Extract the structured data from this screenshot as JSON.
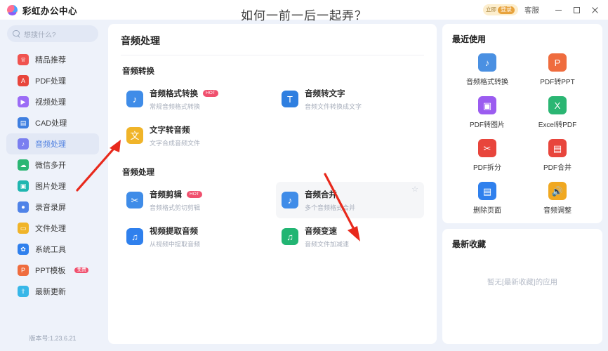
{
  "titlebar": {
    "brand": "彩虹办公中心",
    "login_left": "立即",
    "login_right": "登录",
    "service": "客服",
    "minimize_icon": "minimize-icon",
    "maximize_icon": "maximize-icon",
    "close_icon": "close-icon"
  },
  "overlay": {
    "caption": "如何一前一后一起弄？"
  },
  "sidebar": {
    "search_placeholder": "想搜什么?",
    "version": "版本号:1.23.6.21",
    "items": [
      {
        "label": "精品推荐",
        "icon": "gift-icon",
        "color": "#f0534f",
        "glyph": "♕",
        "active": false
      },
      {
        "label": "PDF处理",
        "icon": "pdf-icon",
        "color": "#e8453c",
        "glyph": "A",
        "active": false
      },
      {
        "label": "视频处理",
        "icon": "video-icon",
        "color": "#9b6cf6",
        "glyph": "▶",
        "active": false
      },
      {
        "label": "CAD处理",
        "icon": "cad-icon",
        "color": "#3f7fe0",
        "glyph": "▤",
        "active": false
      },
      {
        "label": "音频处理",
        "icon": "audio-icon",
        "color": "#7a7ef0",
        "glyph": "♪",
        "active": true
      },
      {
        "label": "微信多开",
        "icon": "wechat-icon",
        "color": "#2bb673",
        "glyph": "☁",
        "active": false
      },
      {
        "label": "图片处理",
        "icon": "image-icon",
        "color": "#1fb6b0",
        "glyph": "▣",
        "active": false
      },
      {
        "label": "录音录屏",
        "icon": "record-icon",
        "color": "#4f83e8",
        "glyph": "⏺",
        "active": false
      },
      {
        "label": "文件处理",
        "icon": "folder-icon",
        "color": "#f0b429",
        "glyph": "▭",
        "active": false
      },
      {
        "label": "系统工具",
        "icon": "gear-icon",
        "color": "#2f80ed",
        "glyph": "✿",
        "active": false
      },
      {
        "label": "PPT模板",
        "icon": "ppt-icon",
        "color": "#ef6c3e",
        "glyph": "P",
        "active": false,
        "badge": "免费"
      },
      {
        "label": "最新更新",
        "icon": "update-icon",
        "color": "#37b7e8",
        "glyph": "⇪",
        "active": false
      }
    ]
  },
  "main": {
    "page_title": "音频处理",
    "groups": [
      {
        "title": "音频转换",
        "tools": [
          {
            "name": "音频格式转换",
            "sub": "常规音频格式转换",
            "icon": "audio-convert-icon",
            "color": "#3f8ce8",
            "glyph": "♪",
            "badge": "HOT",
            "highlight": false,
            "star": false
          },
          {
            "name": "音频转文字",
            "sub": "音频文件转换成文字",
            "icon": "audio-to-text-icon",
            "color": "#2f7fe0",
            "glyph": "T",
            "badge": "",
            "highlight": false,
            "star": false
          },
          {
            "name": "文字转音频",
            "sub": "文字合成音频文件",
            "icon": "text-to-audio-icon",
            "color": "#f0b429",
            "glyph": "文",
            "badge": "",
            "highlight": false,
            "star": false
          }
        ]
      },
      {
        "title": "音频处理",
        "tools": [
          {
            "name": "音频剪辑",
            "sub": "音频格式剪切剪辑",
            "icon": "audio-clip-icon",
            "color": "#3f8ce8",
            "glyph": "✂",
            "badge": "HOT",
            "highlight": false,
            "star": false
          },
          {
            "name": "音频合并",
            "sub": "多个音频格式合并",
            "icon": "audio-merge-icon",
            "color": "#3f8ce8",
            "glyph": "♪",
            "badge": "",
            "highlight": true,
            "star": true
          },
          {
            "name": "视频提取音频",
            "sub": "从视频中提取音频",
            "icon": "video-extract-icon",
            "color": "#2f80ed",
            "glyph": "♫",
            "badge": "",
            "highlight": false,
            "star": false
          },
          {
            "name": "音频变速",
            "sub": "音频文件加减速",
            "icon": "audio-speed-icon",
            "color": "#22b573",
            "glyph": "♫",
            "badge": "",
            "highlight": false,
            "star": false
          }
        ]
      }
    ]
  },
  "recent": {
    "title": "最近使用",
    "items": [
      {
        "label": "音频格式转换",
        "icon": "audio-convert-icon",
        "color": "#4a90e2",
        "glyph": "♪"
      },
      {
        "label": "PDF转PPT",
        "icon": "pdf-to-ppt-icon",
        "color": "#ef6c3e",
        "glyph": "P"
      },
      {
        "label": "PDF转图片",
        "icon": "pdf-to-image-icon",
        "color": "#9b5cf0",
        "glyph": "▣"
      },
      {
        "label": "Excel转PDF",
        "icon": "excel-to-pdf-icon",
        "color": "#2bb673",
        "glyph": "X"
      },
      {
        "label": "PDF拆分",
        "icon": "pdf-split-icon",
        "color": "#e8453c",
        "glyph": "✂"
      },
      {
        "label": "PDF合并",
        "icon": "pdf-merge-icon",
        "color": "#e8453c",
        "glyph": "▤"
      },
      {
        "label": "删除页面",
        "icon": "delete-page-icon",
        "color": "#2f80ed",
        "glyph": "▤"
      },
      {
        "label": "音频调整",
        "icon": "audio-adjust-icon",
        "color": "#f0a821",
        "glyph": "🔊"
      }
    ]
  },
  "favorites": {
    "title": "最新收藏",
    "empty_text": "暂无[最新收藏]的应用"
  },
  "colors": {
    "accent": "#4e7fe0",
    "hot_badge": "#f0506e",
    "panel_bg": "#ffffff",
    "app_bg": "#eef2fa",
    "arrow": "#e8291c"
  }
}
